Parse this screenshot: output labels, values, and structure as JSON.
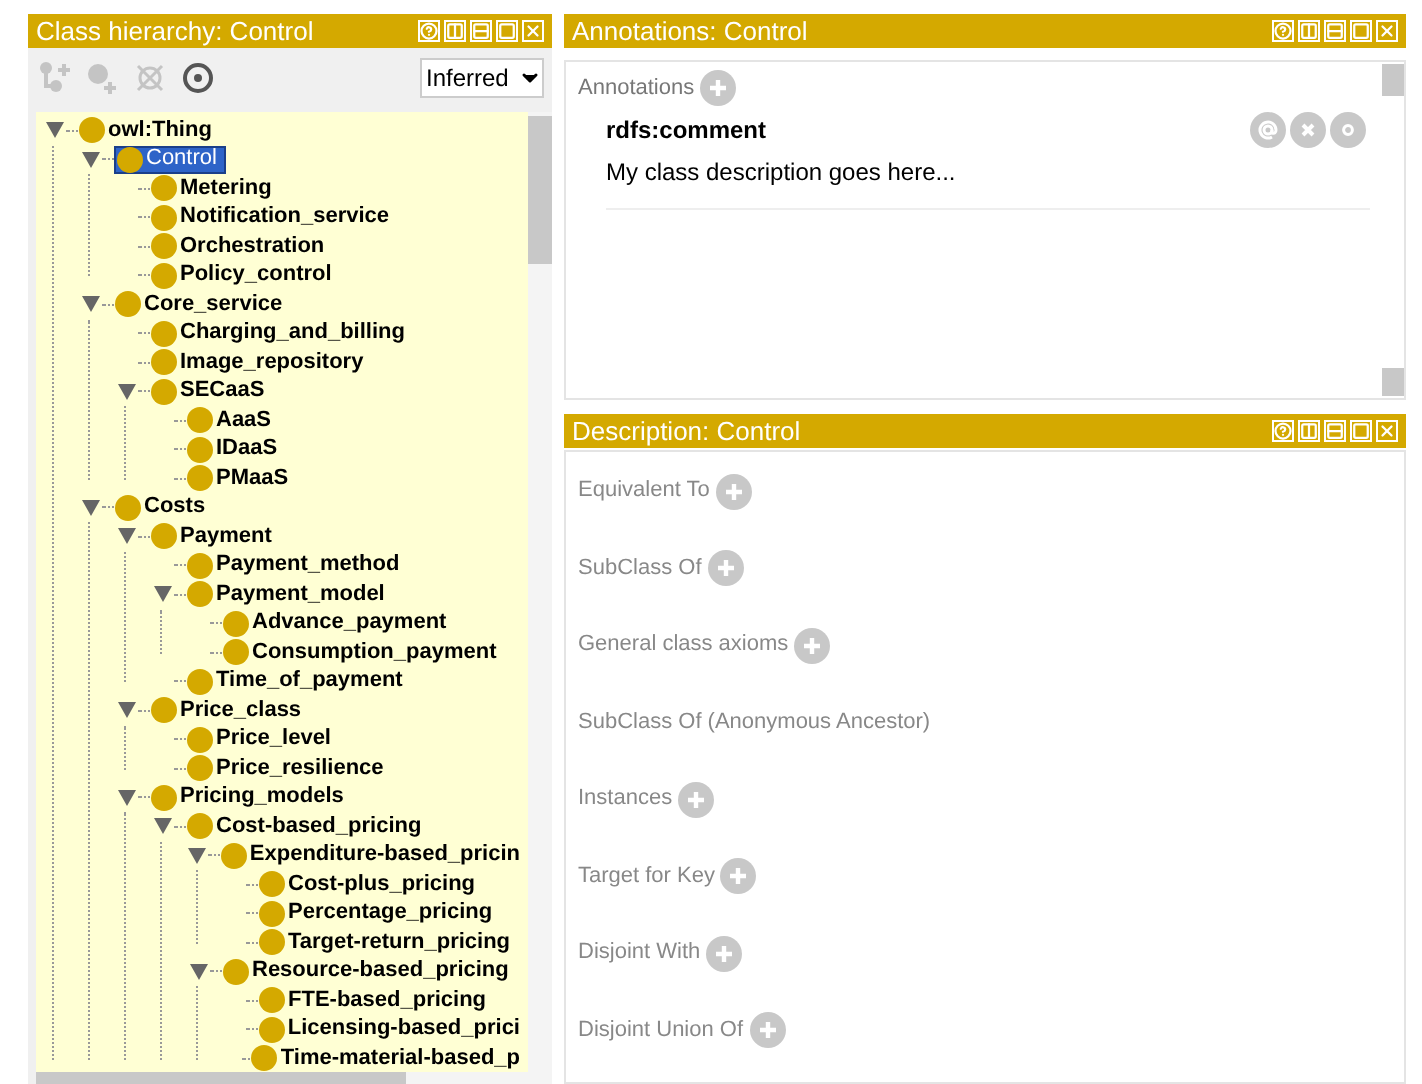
{
  "hierarchy": {
    "title": "Class hierarchy: Control",
    "toolbar": [
      {
        "kind": "add-subclass",
        "disabled": true
      },
      {
        "kind": "add-sibling",
        "disabled": true
      },
      {
        "kind": "delete",
        "disabled": true
      },
      {
        "kind": "watch",
        "disabled": false
      }
    ],
    "mode": {
      "value": "Inferred"
    },
    "tree": [
      {
        "label": "owl:Thing",
        "selected": false,
        "expanded": true,
        "children": [
          {
            "label": "Control",
            "selected": true,
            "expanded": true,
            "children": [
              {
                "label": "Metering",
                "selected": false
              },
              {
                "label": "Notification_service",
                "selected": false
              },
              {
                "label": "Orchestration",
                "selected": false
              },
              {
                "label": "Policy_control",
                "selected": false
              }
            ]
          },
          {
            "label": "Core_service",
            "selected": false,
            "expanded": true,
            "children": [
              {
                "label": "Charging_and_billing",
                "selected": false
              },
              {
                "label": "Image_repository",
                "selected": false
              },
              {
                "label": "SECaaS",
                "selected": false,
                "expanded": true,
                "children": [
                  {
                    "label": "AaaS",
                    "selected": false
                  },
                  {
                    "label": "IDaaS",
                    "selected": false
                  },
                  {
                    "label": "PMaaS",
                    "selected": false
                  }
                ]
              }
            ]
          },
          {
            "label": "Costs",
            "selected": false,
            "expanded": true,
            "children": [
              {
                "label": "Payment",
                "selected": false,
                "expanded": true,
                "children": [
                  {
                    "label": "Payment_method",
                    "selected": false
                  },
                  {
                    "label": "Payment_model",
                    "selected": false,
                    "expanded": true,
                    "children": [
                      {
                        "label": "Advance_payment",
                        "selected": false
                      },
                      {
                        "label": "Consumption_payment",
                        "selected": false
                      }
                    ]
                  },
                  {
                    "label": "Time_of_payment",
                    "selected": false
                  }
                ]
              },
              {
                "label": "Price_class",
                "selected": false,
                "expanded": true,
                "children": [
                  {
                    "label": "Price_level",
                    "selected": false
                  },
                  {
                    "label": "Price_resilience",
                    "selected": false
                  }
                ]
              },
              {
                "label": "Pricing_models",
                "selected": false,
                "expanded": true,
                "children": [
                  {
                    "label": "Cost-based_pricing",
                    "selected": false,
                    "expanded": true,
                    "children": [
                      {
                        "label": "Expenditure-based_pricin",
                        "selected": false,
                        "expanded": true,
                        "children": [
                          {
                            "label": "Cost-plus_pricing",
                            "selected": false
                          },
                          {
                            "label": "Percentage_pricing",
                            "selected": false
                          },
                          {
                            "label": "Target-return_pricing",
                            "selected": false
                          }
                        ]
                      },
                      {
                        "label": "Resource-based_pricing",
                        "selected": false,
                        "expanded": true,
                        "children": [
                          {
                            "label": "FTE-based_pricing",
                            "selected": false
                          },
                          {
                            "label": "Licensing-based_prici",
                            "selected": false
                          },
                          {
                            "label": "Time-material-based_p",
                            "selected": false
                          }
                        ]
                      }
                    ]
                  }
                ]
              }
            ]
          }
        ]
      }
    ]
  },
  "annotations": {
    "title": "Annotations: Control",
    "section": "Annotations",
    "items": [
      {
        "property": "rdfs:comment",
        "value": "My class description goes here..."
      }
    ]
  },
  "description": {
    "title": "Description: Control",
    "sections": [
      {
        "label": "Equivalent To",
        "add_button": true
      },
      {
        "label": "SubClass Of",
        "add_button": true
      },
      {
        "label": "General class axioms",
        "add_button": true
      },
      {
        "label": "SubClass Of (Anonymous Ancestor)",
        "add_button": false
      },
      {
        "label": "Instances",
        "add_button": true
      },
      {
        "label": "Target for Key",
        "add_button": true
      },
      {
        "label": "Disjoint With",
        "add_button": true
      },
      {
        "label": "Disjoint Union Of",
        "add_button": true
      }
    ]
  }
}
